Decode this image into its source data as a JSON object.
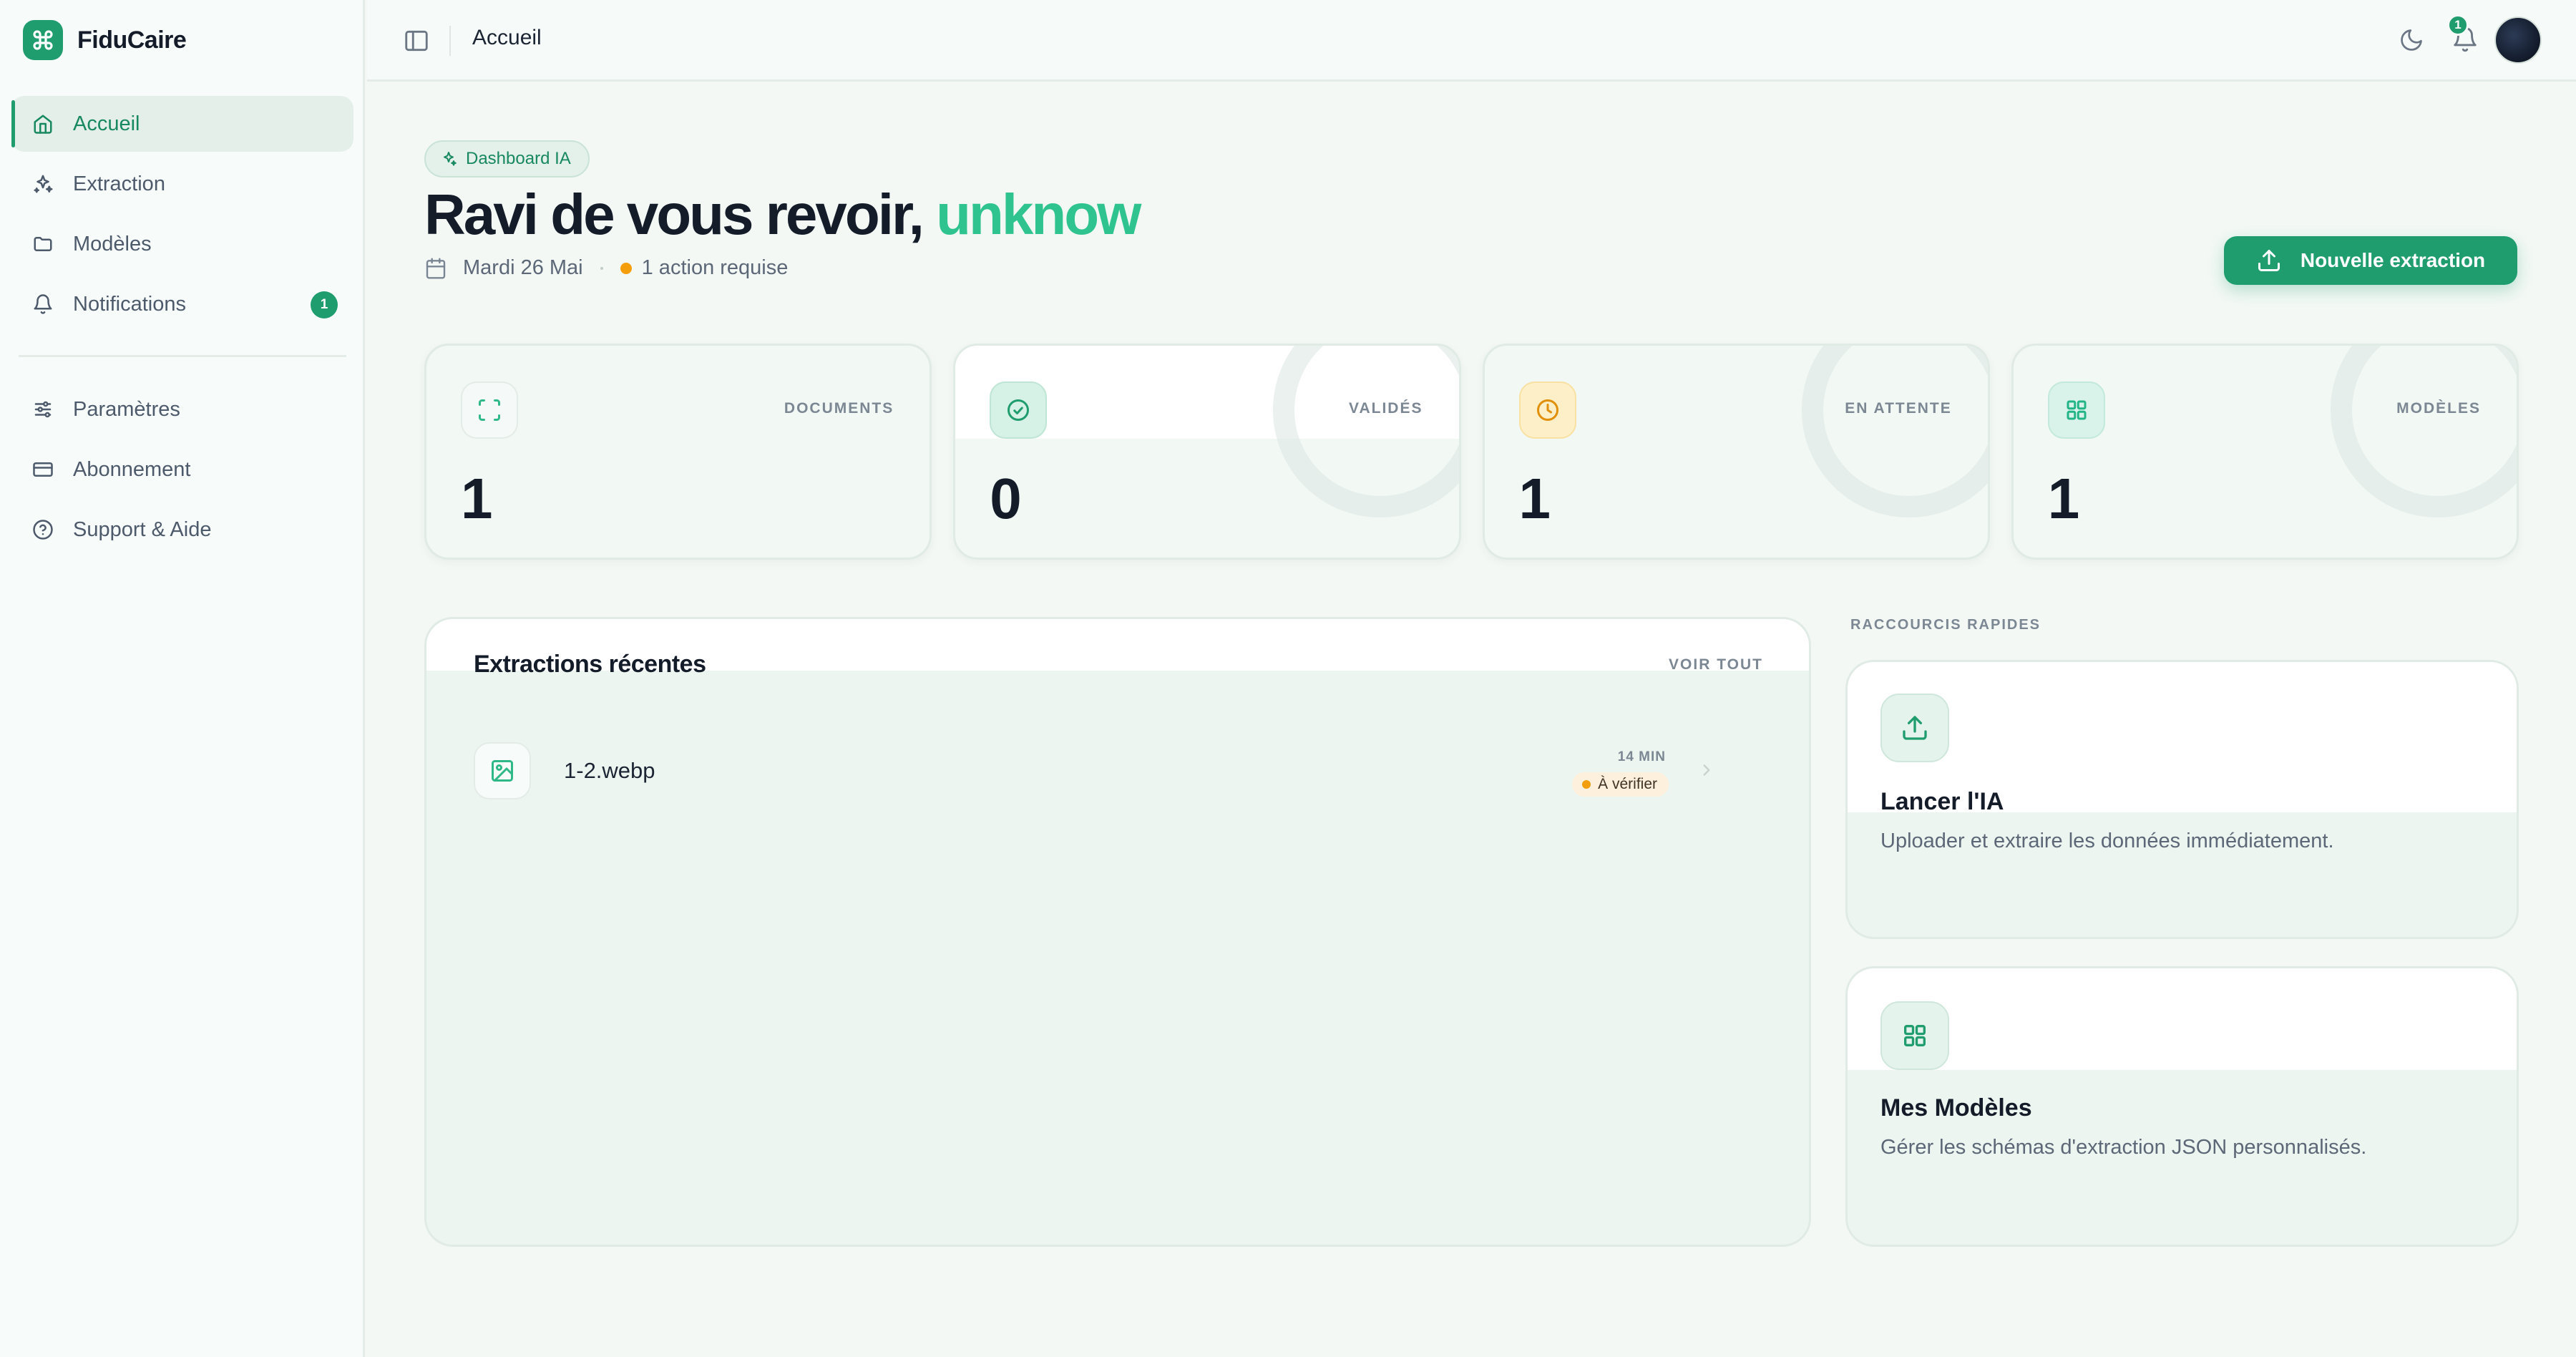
{
  "brand": {
    "name": "FiduCaire",
    "logo_icon": "command-icon",
    "color": "#1f9d6e"
  },
  "sidebar": {
    "items": [
      {
        "label": "Accueil",
        "icon": "home-icon",
        "active": true
      },
      {
        "label": "Extraction",
        "icon": "sparkles-icon"
      },
      {
        "label": "Modèles",
        "icon": "folder-icon"
      },
      {
        "label": "Notifications",
        "icon": "bell-icon",
        "badge": "1"
      },
      {
        "label": "Paramètres",
        "icon": "sliders-icon"
      },
      {
        "label": "Abonnement",
        "icon": "credit-card-icon"
      },
      {
        "label": "Support & Aide",
        "icon": "help-circle-icon"
      }
    ]
  },
  "topbar": {
    "breadcrumb": "Accueil",
    "notification_count": "1"
  },
  "hero": {
    "pill": "Dashboard IA",
    "greeting": "Ravi de vous revoir,",
    "username": "unknow",
    "date": "Mardi 26 Mai",
    "action": "1 action requise",
    "cta": "Nouvelle extraction"
  },
  "stats": [
    {
      "label": "DOCUMENTS",
      "value": "1",
      "icon": "scan-icon"
    },
    {
      "label": "VALIDÉS",
      "value": "0",
      "icon": "check-circle-icon"
    },
    {
      "label": "EN ATTENTE",
      "value": "1",
      "icon": "clock-icon"
    },
    {
      "label": "MODÈLES",
      "value": "1",
      "icon": "grid-icon"
    }
  ],
  "recent": {
    "title": "Extractions récentes",
    "see_all": "VOIR TOUT",
    "rows": [
      {
        "name": "1-2.webp",
        "time": "14 MIN",
        "status": "À vérifier",
        "icon": "image-icon"
      }
    ]
  },
  "shortcuts": {
    "label": "RACCOURCIS RAPIDES",
    "cards": [
      {
        "title": "Lancer l'IA",
        "desc": "Uploader et extraire les données immédiatement.",
        "icon": "upload-icon"
      },
      {
        "title": "Mes Modèles",
        "desc": "Gérer les schémas d'extraction JSON personnalisés.",
        "icon": "grid-icon"
      }
    ]
  }
}
